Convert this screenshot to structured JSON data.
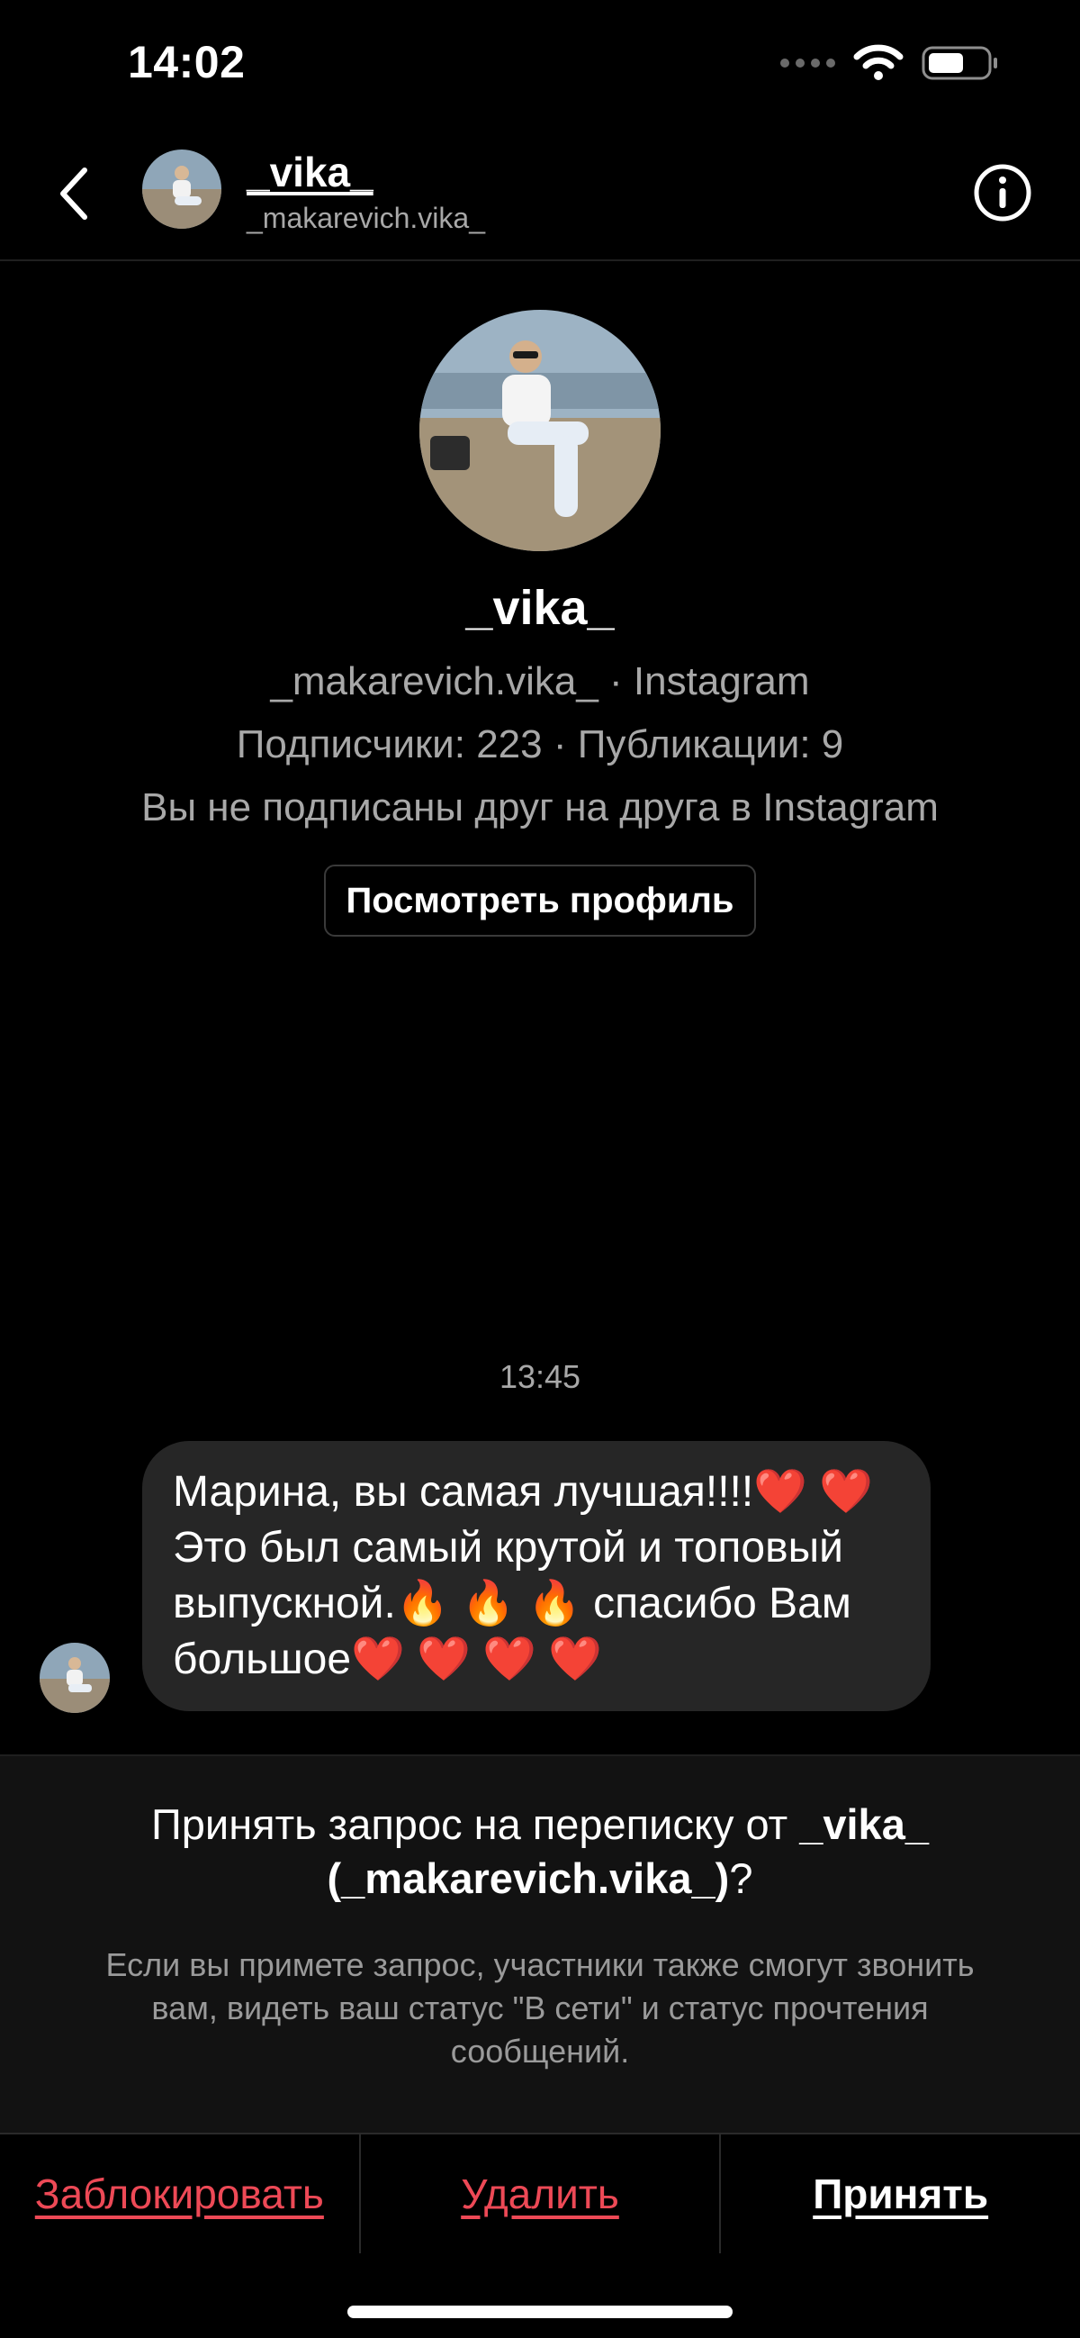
{
  "status_bar": {
    "time": "14:02"
  },
  "header": {
    "display_name": "_vika_",
    "username": "_makarevich.vika_"
  },
  "profile": {
    "name": "_vika_",
    "subtitle": "_makarevich.vika_ · Instagram",
    "stats": "Подписчики: 223 · Публикации: 9",
    "relation": "Вы не подписаны друг на друга в Instagram",
    "view_profile_label": "Посмотреть профиль"
  },
  "thread": {
    "timestamp": "13:45",
    "messages": [
      {
        "line1": "Марина, вы самая лучшая!!!!❤️ ❤️",
        "line2": "Это был самый крутой и топовый",
        "line3": "выпускной.🔥 🔥 🔥  спасибо Вам",
        "line4": "большое❤️ ❤️ ❤️ ❤️"
      }
    ]
  },
  "request": {
    "title_prefix": "Принять запрос на переписку от ",
    "title_name": "_vika_",
    "title_username": "(_makarevich.vika_)",
    "title_suffix": "?",
    "note": "Если вы примете запрос, участники также смогут звонить вам, видеть ваш статус \"В сети\" и статус прочтения сообщений."
  },
  "actions": {
    "block_label": "Заблокировать",
    "delete_label": "Удалить",
    "accept_label": "Принять"
  },
  "colors": {
    "background": "#000000",
    "bubble": "#262626",
    "panel": "#121212",
    "danger": "#ed4956",
    "secondary_text": "#a8a8a8"
  },
  "icons": [
    "back-chevron-icon",
    "info-icon",
    "wifi-icon",
    "battery-icon",
    "cellular-signal-icon"
  ]
}
